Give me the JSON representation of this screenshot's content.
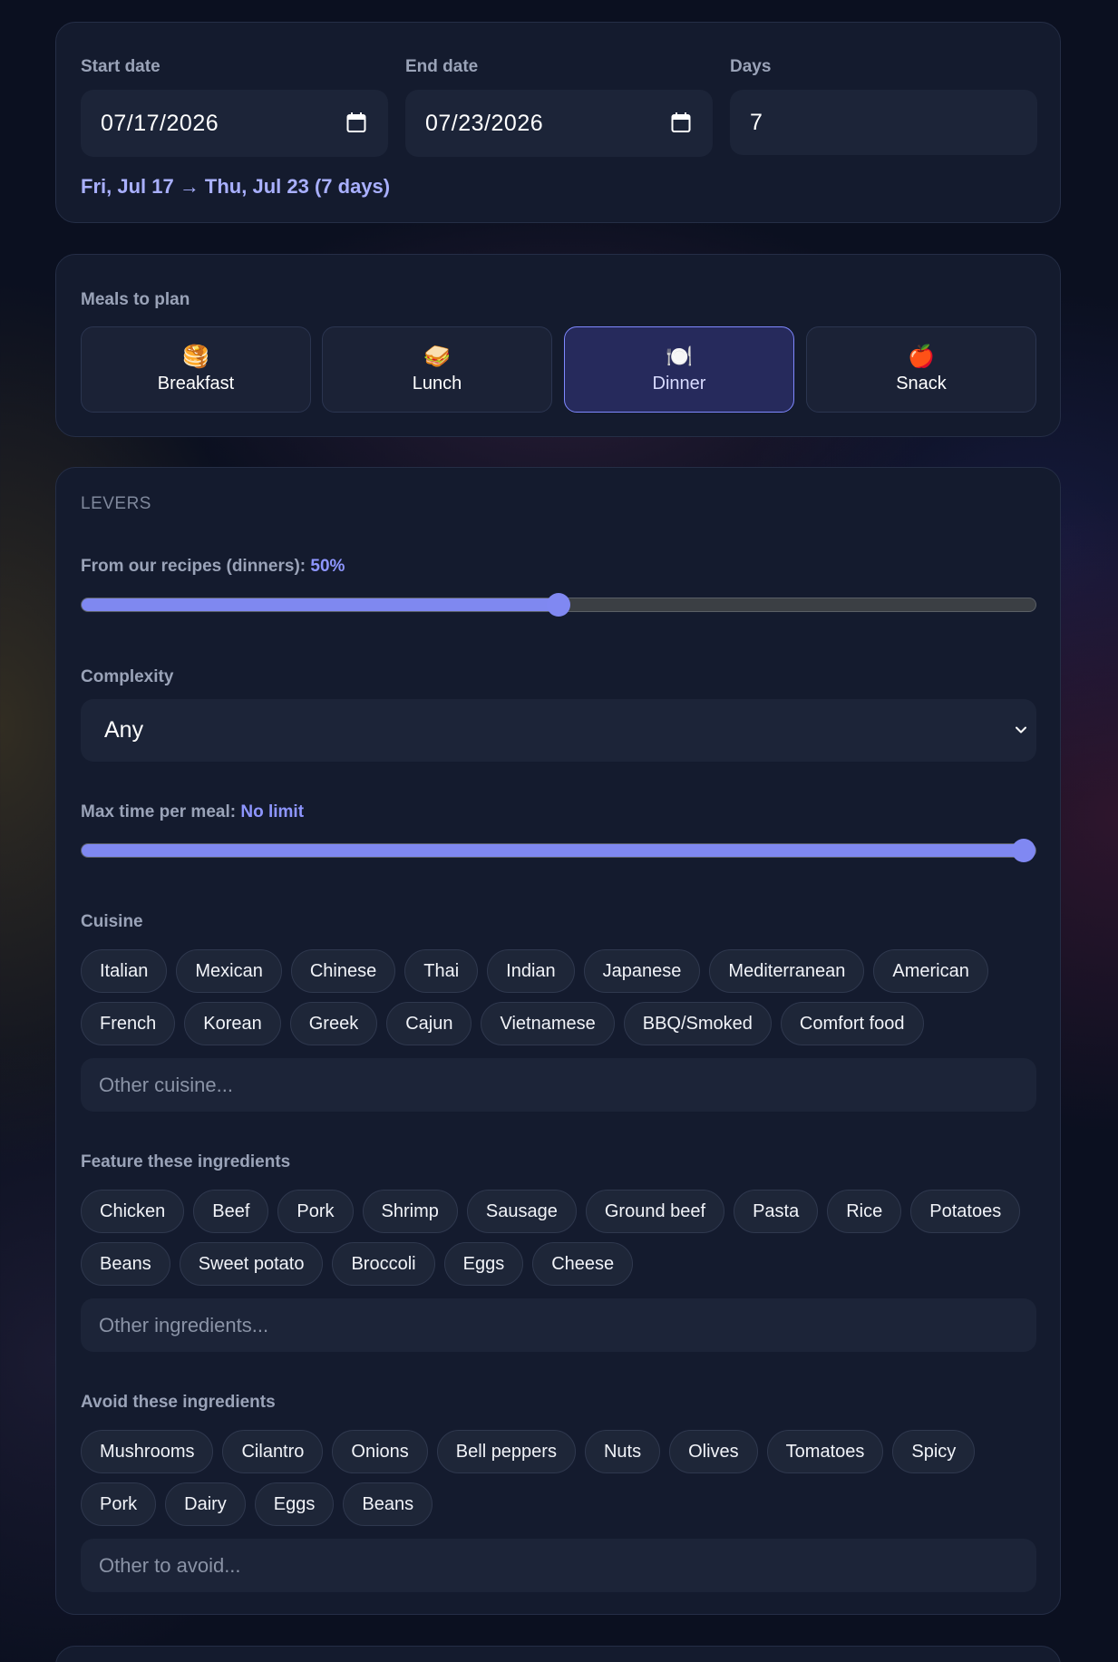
{
  "dates": {
    "start_label": "Start date",
    "start_value": "07/17/2026",
    "end_label": "End date",
    "end_value": "07/23/2026",
    "days_label": "Days",
    "days_value": "7",
    "range_text": "Fri, Jul 17 → Thu, Jul 23 (7 days)"
  },
  "meals": {
    "label": "Meals to plan",
    "items": [
      {
        "emoji": "🥞",
        "label": "Breakfast",
        "selected": false
      },
      {
        "emoji": "🥪",
        "label": "Lunch",
        "selected": false
      },
      {
        "emoji": "🍽️",
        "label": "Dinner",
        "selected": true
      },
      {
        "emoji": "🍎",
        "label": "Snack",
        "selected": false
      }
    ]
  },
  "levers": {
    "title": "LEVERS",
    "recipes_label": "From our recipes (dinners):",
    "recipes_value": "50%",
    "recipes_fraction": 0.5,
    "complexity_label": "Complexity",
    "complexity_value": "Any",
    "maxtime_label": "Max time per meal:",
    "maxtime_value": "No limit",
    "maxtime_fraction": 1.0,
    "cuisine_label": "Cuisine",
    "cuisines": [
      "Italian",
      "Mexican",
      "Chinese",
      "Thai",
      "Indian",
      "Japanese",
      "Mediterranean",
      "American",
      "French",
      "Korean",
      "Greek",
      "Cajun",
      "Vietnamese",
      "BBQ/Smoked",
      "Comfort food"
    ],
    "cuisine_placeholder": "Other cuisine...",
    "feature_label": "Feature these ingredients",
    "feature": [
      "Chicken",
      "Beef",
      "Pork",
      "Shrimp",
      "Sausage",
      "Ground beef",
      "Pasta",
      "Rice",
      "Potatoes",
      "Beans",
      "Sweet potato",
      "Broccoli",
      "Eggs",
      "Cheese"
    ],
    "feature_placeholder": "Other ingredients...",
    "avoid_label": "Avoid these ingredients",
    "avoid": [
      "Mushrooms",
      "Cilantro",
      "Onions",
      "Bell peppers",
      "Nuts",
      "Olives",
      "Tomatoes",
      "Spicy",
      "Pork",
      "Dairy",
      "Eggs",
      "Beans"
    ],
    "avoid_placeholder": "Other to avoid..."
  },
  "colors": {
    "accent": "#7f88f0",
    "card_bg": "#141b2e",
    "selected_bg": "#262a5c"
  }
}
